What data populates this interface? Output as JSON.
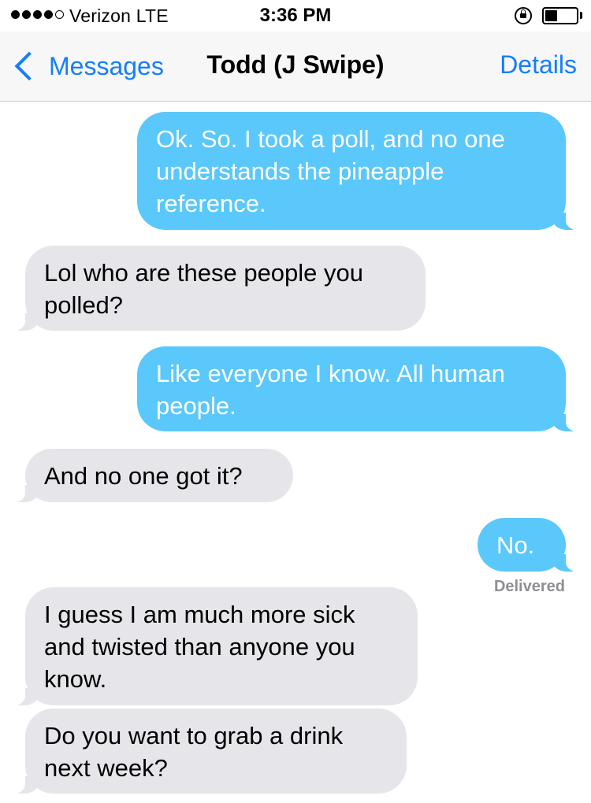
{
  "status_bar": {
    "carrier": "Verizon  LTE",
    "time": "3:36 PM",
    "signal_strength": 4,
    "signal_max": 5,
    "battery_level": 0.4
  },
  "nav": {
    "back_label": "Messages",
    "title": "Todd (J Swipe)",
    "details_label": "Details"
  },
  "colors": {
    "accent": "#157efb",
    "outgoing_bubble": "#5ac8fa",
    "incoming_bubble": "#e5e5ea"
  },
  "messages": [
    {
      "direction": "outgoing",
      "text": "Ok. So. I took a poll, and no one understands the pineapple reference."
    },
    {
      "direction": "incoming",
      "text": "Lol who are these people you polled?"
    },
    {
      "direction": "outgoing",
      "text": "Like everyone I know. All human people."
    },
    {
      "direction": "incoming",
      "text": "And no one got it?"
    },
    {
      "direction": "outgoing",
      "text": "No."
    },
    {
      "direction": "incoming",
      "text": "I guess I am much more sick and twisted than anyone you know."
    },
    {
      "direction": "incoming",
      "text": "Do you want to grab a drink next week?"
    }
  ],
  "delivered_label": "Delivered"
}
